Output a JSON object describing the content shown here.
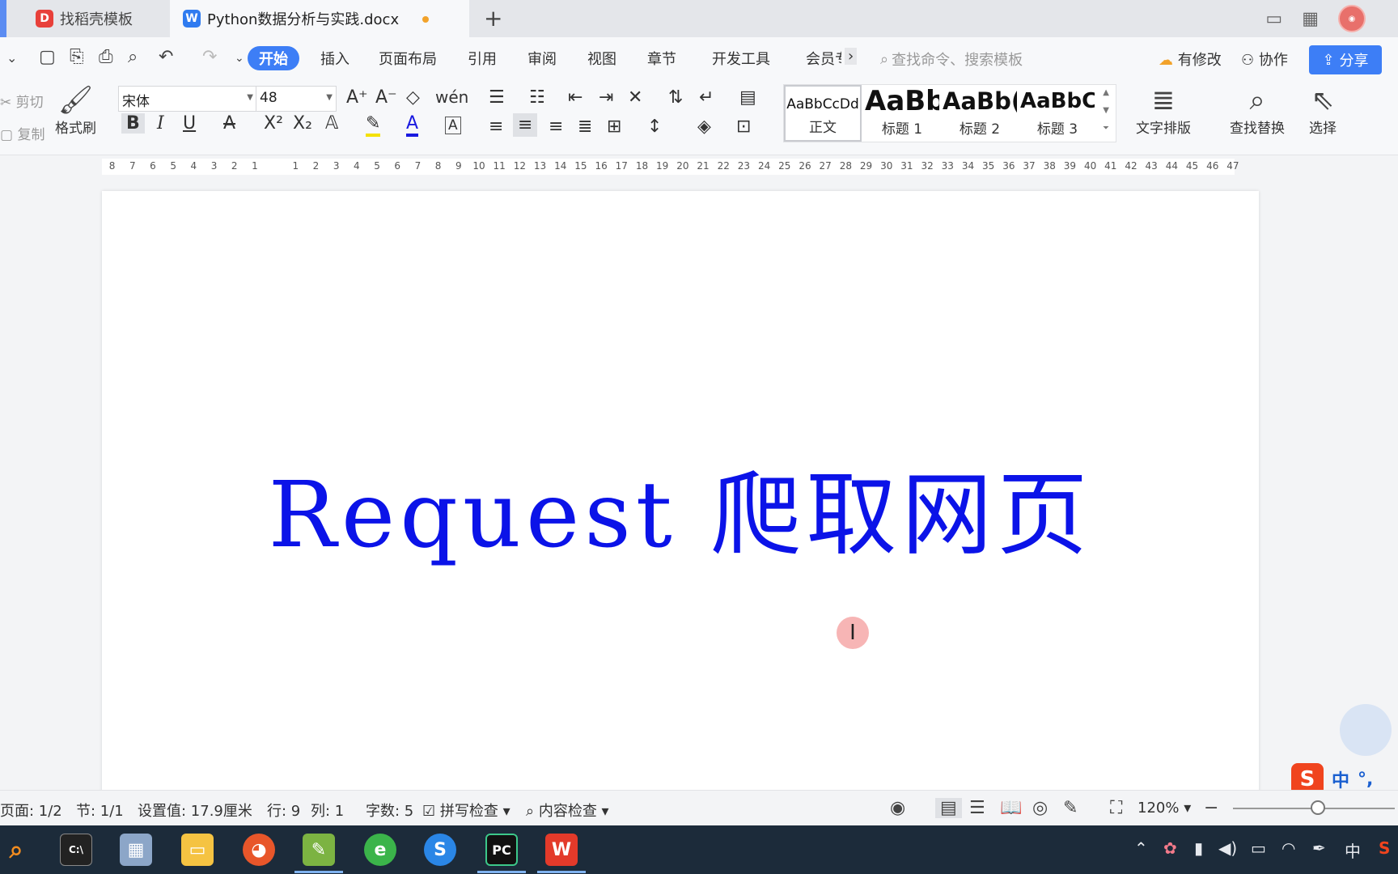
{
  "tabs": {
    "inactive_label": "找稻壳模板",
    "active_label": "Python数据分析与实践.docx",
    "new_tab": "+"
  },
  "menu": {
    "items": [
      "开始",
      "插入",
      "页面布局",
      "引用",
      "审阅",
      "视图",
      "章节",
      "开发工具",
      "会员专"
    ],
    "more": "›",
    "search_placeholder": "查找命令、搜索模板",
    "modify": "有修改",
    "collab": "协作",
    "share": "分享"
  },
  "ribbon": {
    "cut": "剪切",
    "copy": "复制",
    "format_painter": "格式刷",
    "font_name": "宋体",
    "font_size": "48",
    "styles": [
      {
        "preview": "AaBbCcDd",
        "label": "正文"
      },
      {
        "preview": "AaBb",
        "label": "标题 1"
      },
      {
        "preview": "AaBb(",
        "label": "标题 2"
      },
      {
        "preview": "AaBbC(",
        "label": "标题 3"
      }
    ],
    "text_layout": "文字排版",
    "find_replace": "查找替换",
    "select": "选择"
  },
  "ruler": {
    "numbers": [
      "8",
      "7",
      "6",
      "5",
      "4",
      "3",
      "2",
      "1",
      "",
      "1",
      "2",
      "3",
      "4",
      "5",
      "6",
      "7",
      "8",
      "9",
      "10",
      "11",
      "12",
      "13",
      "14",
      "15",
      "16",
      "17",
      "18",
      "19",
      "20",
      "21",
      "22",
      "23",
      "24",
      "25",
      "26",
      "27",
      "28",
      "29",
      "30",
      "31",
      "32",
      "33",
      "34",
      "35",
      "36",
      "37",
      "38",
      "39",
      "40",
      "41",
      "42",
      "43",
      "44",
      "45",
      "46",
      "47"
    ]
  },
  "document": {
    "title": "Request 爬取网页",
    "title_color": "#0b13e8"
  },
  "ime": {
    "label": "中",
    "punct": "°,"
  },
  "status": {
    "page": "页面: 1/2",
    "section": "节: 1/1",
    "setting": "设置值: 17.9厘米",
    "row": "行: 9",
    "col": "列: 1",
    "words": "字数: 5",
    "spell": "拼写检查",
    "content": "内容检查",
    "zoom": "120%"
  },
  "taskbar": {
    "tray_lang": "中"
  },
  "colors": {
    "accent": "#3d7ef6",
    "tab_dot": "#f2a22a"
  }
}
